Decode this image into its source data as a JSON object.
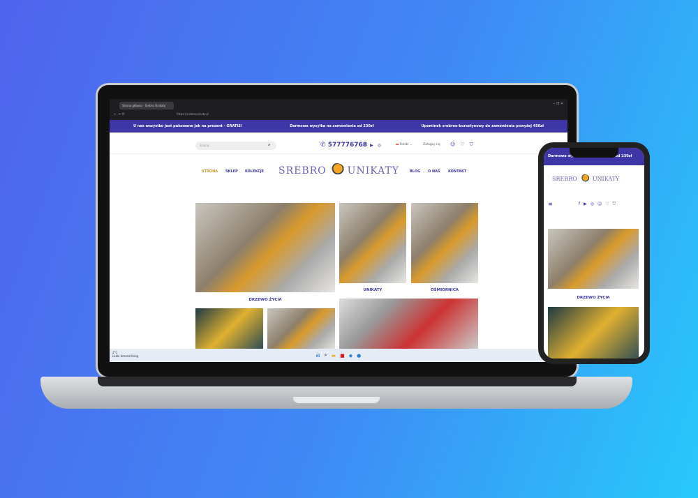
{
  "browser": {
    "tab_title": "Strona główna - Srebro Unikaty",
    "url": "https://srebrounikaty.pl"
  },
  "promo": [
    "U nas wszystko jest pakowane jak na prezent - GRATIS!",
    "Darmowa wysyłka na zamówienia od 230zł",
    "Upominek srebrno-bursztynowy do zamówienia powyżej 450zł"
  ],
  "header": {
    "search_placeholder": "Szukaj...",
    "phone": "577776768",
    "language": "Polski",
    "login": "Zaloguj się",
    "wishlist_count": "0",
    "cart_count": "0"
  },
  "nav": {
    "left": [
      "STRONA",
      "SKLEP",
      "KOLEKCJE"
    ],
    "right": [
      "BLOG",
      "O NAS",
      "KONTAKT"
    ],
    "logo_left": "SREBRO",
    "logo_right": "UNIKATY",
    "active_color": "#c8962a",
    "brand_color": "#3e36a6"
  },
  "collections": [
    "DRZEWO ŻYCIA",
    "UNIKATY",
    "OŚMIORNICA"
  ],
  "taskbar": {
    "temp": "2°C",
    "weather": "Lekki deszcz/śnieg"
  },
  "phone": {
    "promo": "Darmowa wysyłka na zamówienia od 230zł",
    "caption": "DRZEWO ŻYCIA"
  }
}
